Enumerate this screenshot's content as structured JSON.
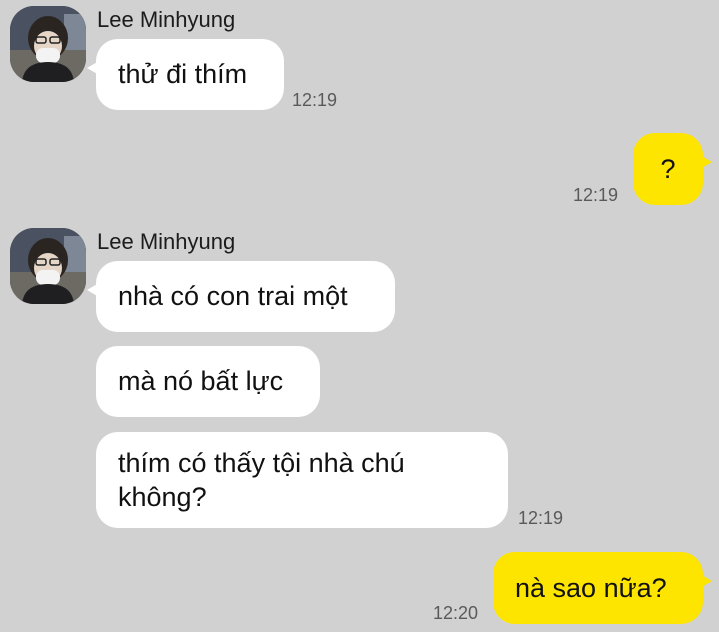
{
  "chat": {
    "messages": [
      {
        "sender": "Lee Minhyung",
        "direction": "incoming",
        "avatar_icon": "profile-photo-icon",
        "bubbles": [
          {
            "text": "thử đi thím",
            "time": "12:19"
          }
        ]
      },
      {
        "direction": "outgoing",
        "bubbles": [
          {
            "text": "?",
            "time": "12:19"
          }
        ]
      },
      {
        "sender": "Lee Minhyung",
        "direction": "incoming",
        "avatar_icon": "profile-photo-icon",
        "bubbles": [
          {
            "text": "nhà có con trai một"
          },
          {
            "text": "mà nó bất lực"
          },
          {
            "text": "thím có thấy tội nhà chú không?",
            "time": "12:19"
          }
        ]
      },
      {
        "direction": "outgoing",
        "bubbles": [
          {
            "text": "nà sao nữa?",
            "time": "12:20"
          }
        ]
      }
    ]
  },
  "colors": {
    "background": "#d1d1d1",
    "incoming_bubble": "#ffffff",
    "outgoing_bubble": "#fee500",
    "timestamp": "#5a5a5a"
  }
}
